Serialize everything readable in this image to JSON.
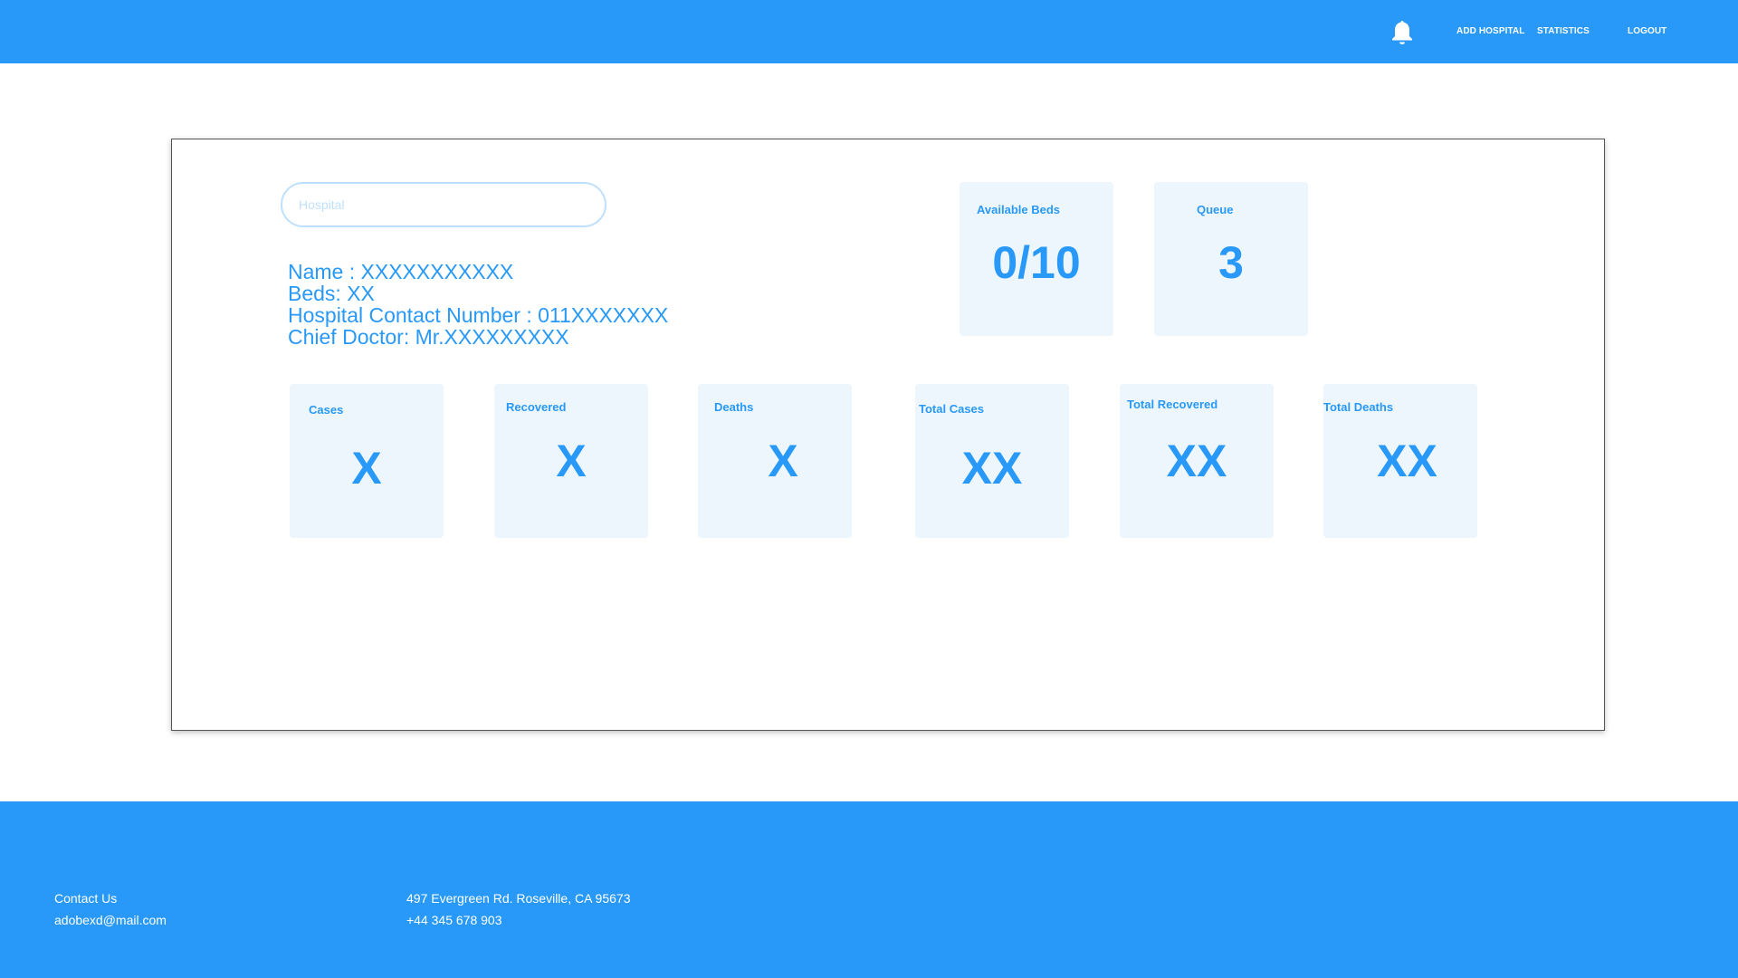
{
  "nav": {
    "add_hospital": "ADD HOSPITAL",
    "statistics": "STATISTICS",
    "logout": "LOGOUT"
  },
  "search": {
    "placeholder": "Hospital"
  },
  "info": {
    "name": "Name : XXXXXXXXXXX",
    "beds": "Beds: XX",
    "contact": "Hospital Contact Number : 011XXXXXXX",
    "doctor": "Chief Doctor: Mr.XXXXXXXXX"
  },
  "summary": {
    "available_beds": {
      "label": "Available Beds",
      "value": "0/10"
    },
    "queue": {
      "label": "Queue",
      "value": "3"
    }
  },
  "stats": [
    {
      "label": "Cases",
      "value": "X"
    },
    {
      "label": "Recovered",
      "value": "X"
    },
    {
      "label": "Deaths",
      "value": "X"
    },
    {
      "label": "Total Cases",
      "value": "XX"
    },
    {
      "label": "Total Recovered",
      "value": "XX"
    },
    {
      "label": "Total Deaths",
      "value": "XX"
    }
  ],
  "footer": {
    "contact_label": "Contact Us",
    "email": "adobexd@mail.com",
    "address": "497 Evergreen Rd. Roseville, CA 95673",
    "phone": "+44 345 678 903"
  },
  "colors": {
    "primary": "#2899f9",
    "box_bg": "#eef6fd"
  }
}
